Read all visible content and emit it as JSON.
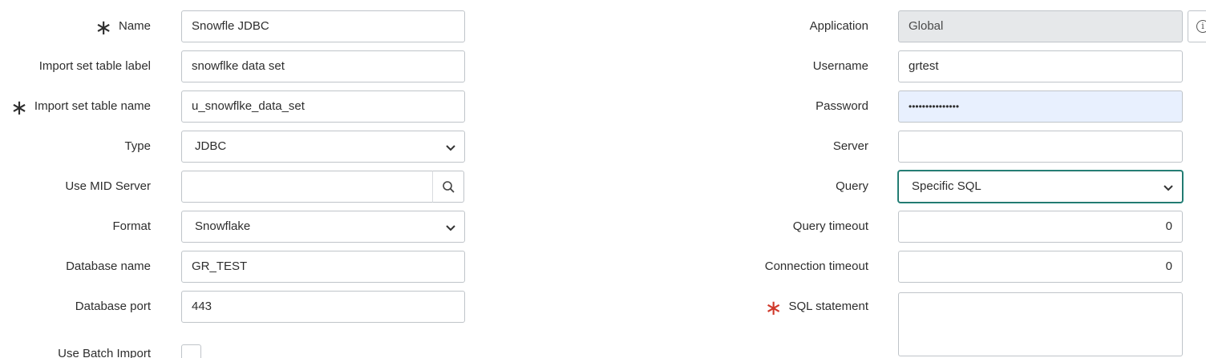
{
  "left": {
    "name": {
      "label": "Name",
      "value": "Snowfle JDBC"
    },
    "import_label": {
      "label": "Import set table label",
      "value": "snowflke data set"
    },
    "import_name": {
      "label": "Import set table name",
      "value": "u_snowflke_data_set"
    },
    "type": {
      "label": "Type",
      "value": "JDBC"
    },
    "mid_server": {
      "label": "Use MID Server",
      "value": ""
    },
    "format": {
      "label": "Format",
      "value": "Snowflake"
    },
    "database_name": {
      "label": "Database name",
      "value": "GR_TEST"
    },
    "database_port": {
      "label": "Database port",
      "value": "443"
    },
    "batch_import": {
      "label": "Use Batch Import",
      "checked": false
    }
  },
  "right": {
    "application": {
      "label": "Application",
      "value": "Global"
    },
    "username": {
      "label": "Username",
      "value": "grtest"
    },
    "password": {
      "label": "Password",
      "value": "•••••••••••••••"
    },
    "server": {
      "label": "Server",
      "value": ""
    },
    "query": {
      "label": "Query",
      "value": "Specific SQL"
    },
    "query_timeout": {
      "label": "Query timeout",
      "value": "0"
    },
    "connection_timeout": {
      "label": "Connection timeout",
      "value": "0"
    },
    "sql_statement": {
      "label": "SQL statement",
      "value": ""
    }
  },
  "icons": {
    "required": "asterisk-icon",
    "search": "search-icon",
    "dropdown": "chevron-down-icon",
    "info": "info-icon"
  },
  "colors": {
    "required_mandatory_empty": "#d0392b",
    "focus_border": "#1f6e66",
    "autofill_bg": "#e8f0fe",
    "readonly_bg": "#e6e8ea"
  }
}
